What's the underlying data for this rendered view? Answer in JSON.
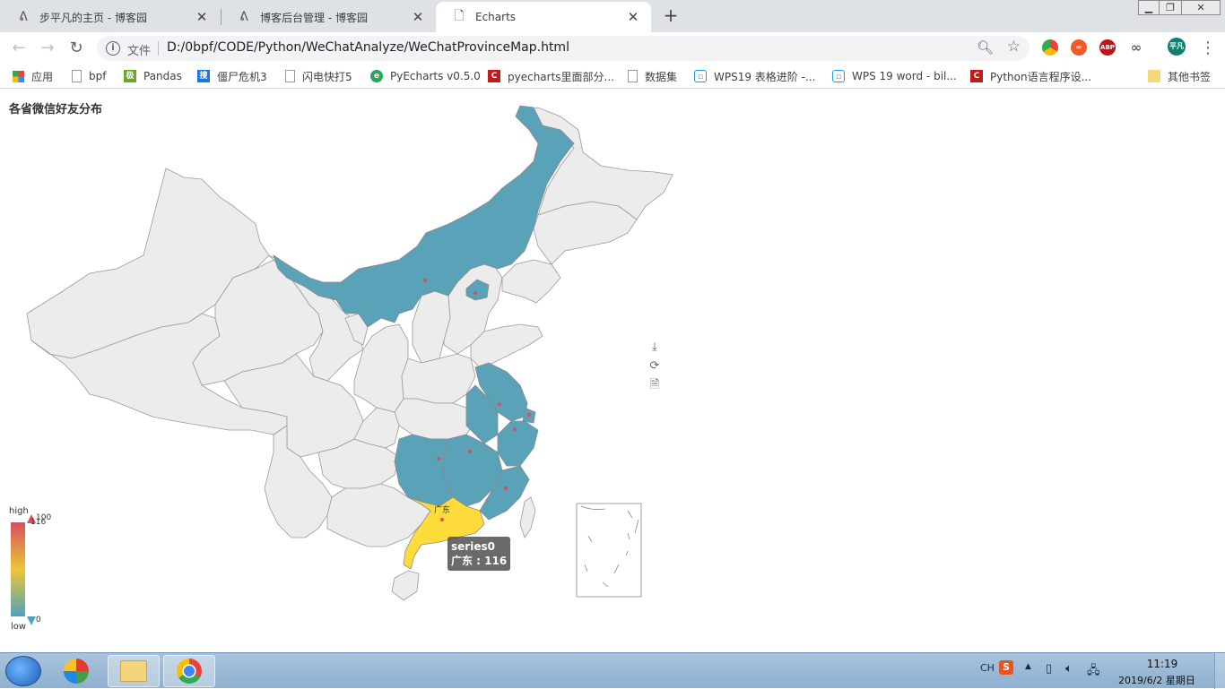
{
  "browser": {
    "tabs": [
      {
        "title": "步平凡的主页 - 博客园",
        "icon": "cnblogs-icon"
      },
      {
        "title": "博客后台管理 - 博客园",
        "icon": "cnblogs-icon"
      },
      {
        "title": "Echarts",
        "icon": "page-icon",
        "active": true
      }
    ],
    "omnibox": {
      "security_label": "文件",
      "url": "D:/0bpf/CODE/Python/WeChatAnalyze/WeChatProvinceMap.html"
    },
    "profile_label": "平凡",
    "ext_abp": "ABP",
    "bookmarks": [
      {
        "label": "应用",
        "icon": "apps-grid-icon"
      },
      {
        "label": "bpf",
        "icon": "page-icon"
      },
      {
        "label": "Pandas",
        "icon": "pandas-icon"
      },
      {
        "label": "僵尸危机3",
        "icon": "game-icon"
      },
      {
        "label": "闪电快打5",
        "icon": "page-icon"
      },
      {
        "label": "PyEcharts v0.5.0",
        "icon": "pyecharts-icon"
      },
      {
        "label": "pyecharts里面部分...",
        "icon": "csdn-icon"
      },
      {
        "label": "数据集",
        "icon": "page-icon"
      },
      {
        "label": "WPS19 表格进阶 -...",
        "icon": "bilibili-icon"
      },
      {
        "label": "WPS 19 word - bil...",
        "icon": "bilibili-icon"
      },
      {
        "label": "Python语言程序设...",
        "icon": "csdn-icon"
      },
      {
        "label": "其他书签",
        "icon": "folder-icon"
      }
    ]
  },
  "chart": {
    "title": "各省微信好友分布",
    "tooltip": {
      "series": "series0",
      "label": "广东 : 116"
    },
    "visualmap": {
      "high_label": "high",
      "low_label": "low",
      "max": "100",
      "min": "0",
      "current": "116"
    },
    "highlight_label": "广东",
    "colors": {
      "in_range_high": "#d94e5d",
      "in_range_mid": "#eac736",
      "in_range_low": "#50a3ba",
      "no_data": "#ececec",
      "highlight": "#ffdc3c"
    }
  },
  "chart_data": {
    "type": "map",
    "title": "各省微信好友分布",
    "series": [
      {
        "name": "series0",
        "data": [
          {
            "name": "广东",
            "value": 116
          },
          {
            "name": "内蒙古",
            "value": 1
          },
          {
            "name": "北京",
            "value": 1
          },
          {
            "name": "江苏",
            "value": 1
          },
          {
            "name": "上海",
            "value": 1
          },
          {
            "name": "浙江",
            "value": 1
          },
          {
            "name": "安徽",
            "value": 1
          },
          {
            "name": "湖南",
            "value": 1
          },
          {
            "name": "江西",
            "value": 1
          },
          {
            "name": "福建",
            "value": 1
          }
        ]
      }
    ],
    "visualmap_range": [
      0,
      100
    ]
  },
  "taskbar": {
    "tray_lang": "CH",
    "time": "11:19",
    "date": "2019/6/2 星期日"
  }
}
